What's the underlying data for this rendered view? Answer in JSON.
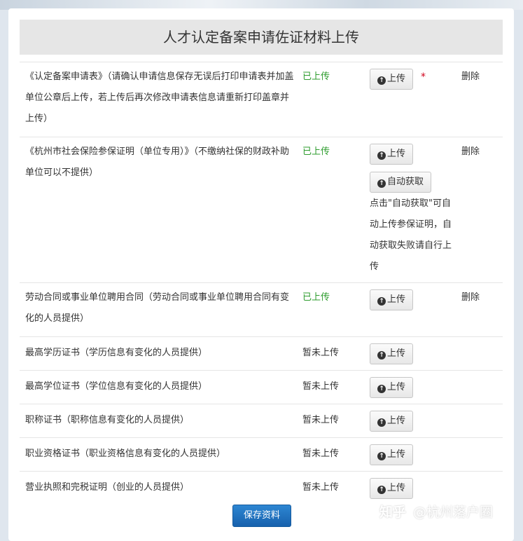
{
  "page": {
    "title": "人才认定备案申请佐证材料上传"
  },
  "rows": [
    {
      "desc": "《认定备案申请表》（请确认申请信息保存无误后打印申请表并加盖单位公章后上传，若上传后再次修改申请表信息请重新打印盖章并上传）",
      "status": "已上传",
      "upload_label": "上传",
      "required_mark": "*",
      "delete_label": "删除"
    },
    {
      "desc": "《杭州市社会保险参保证明（单位专用）》（不缴纳社保的财政补助单位可以不提供）",
      "status": "已上传",
      "upload_label": "上传",
      "auto_label": "自动获取",
      "auto_note": "点击\"自动获取\"可自动上传参保证明，自动获取失败请自行上传",
      "delete_label": "删除"
    },
    {
      "desc": "劳动合同或事业单位聘用合同（劳动合同或事业单位聘用合同有变化的人员提供）",
      "status": "已上传",
      "upload_label": "上传",
      "delete_label": "删除"
    },
    {
      "desc": "最高学历证书（学历信息有变化的人员提供）",
      "status": "暂未上传",
      "upload_label": "上传"
    },
    {
      "desc": "最高学位证书（学位信息有变化的人员提供）",
      "status": "暂未上传",
      "upload_label": "上传"
    },
    {
      "desc": "职称证书（职称信息有变化的人员提供）",
      "status": "暂未上传",
      "upload_label": "上传"
    },
    {
      "desc": "职业资格证书（职业资格信息有变化的人员提供）",
      "status": "暂未上传",
      "upload_label": "上传"
    },
    {
      "desc": "营业执照和完税证明（创业的人员提供）",
      "status": "暂未上传",
      "upload_label": "上传"
    }
  ],
  "save_label": "保存资料",
  "watermark": {
    "site": "知乎",
    "author": "@杭州落户圈"
  },
  "colors": {
    "uploaded": "#2e9c2e",
    "required": "#d0021b",
    "primary": "#1f6fc0"
  },
  "icons": {
    "upload": "arrow-up-circle-icon"
  }
}
